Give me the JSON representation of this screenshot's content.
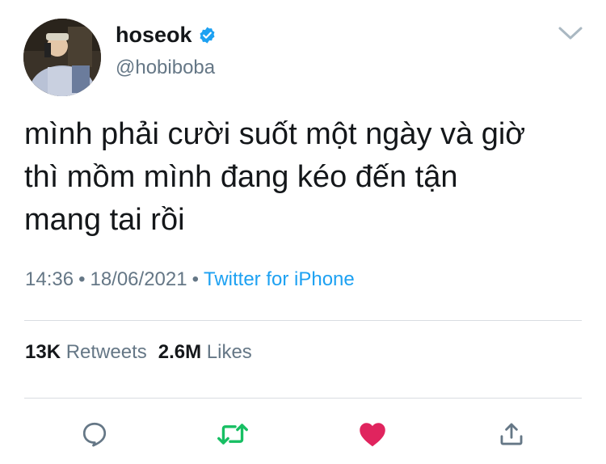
{
  "user": {
    "display_name": "hoseok",
    "handle": "@hobiboba",
    "verified": true,
    "avatar_icon": "avatar-photo"
  },
  "tweet": {
    "lines": [
      "mình phải cười suốt một ngày và giờ",
      "thì mồm mình đang kéo đến tận",
      "mang tai rồi"
    ],
    "time": "14:36",
    "date": "18/06/2021",
    "separator": "•",
    "source": "Twitter for iPhone"
  },
  "stats": {
    "retweets_count": "13K",
    "retweets_label": "Retweets",
    "likes_count": "2.6M",
    "likes_label": "Likes"
  },
  "actions": {
    "reply_icon": "reply-icon",
    "retweet_icon": "retweet-icon",
    "like_icon": "heart-icon",
    "share_icon": "share-icon"
  },
  "colors": {
    "text": "#14171a",
    "secondary": "#657786",
    "link": "#1da1f2",
    "retweet": "#17bf63",
    "like": "#e0245e",
    "divider": "#d9dde1"
  }
}
